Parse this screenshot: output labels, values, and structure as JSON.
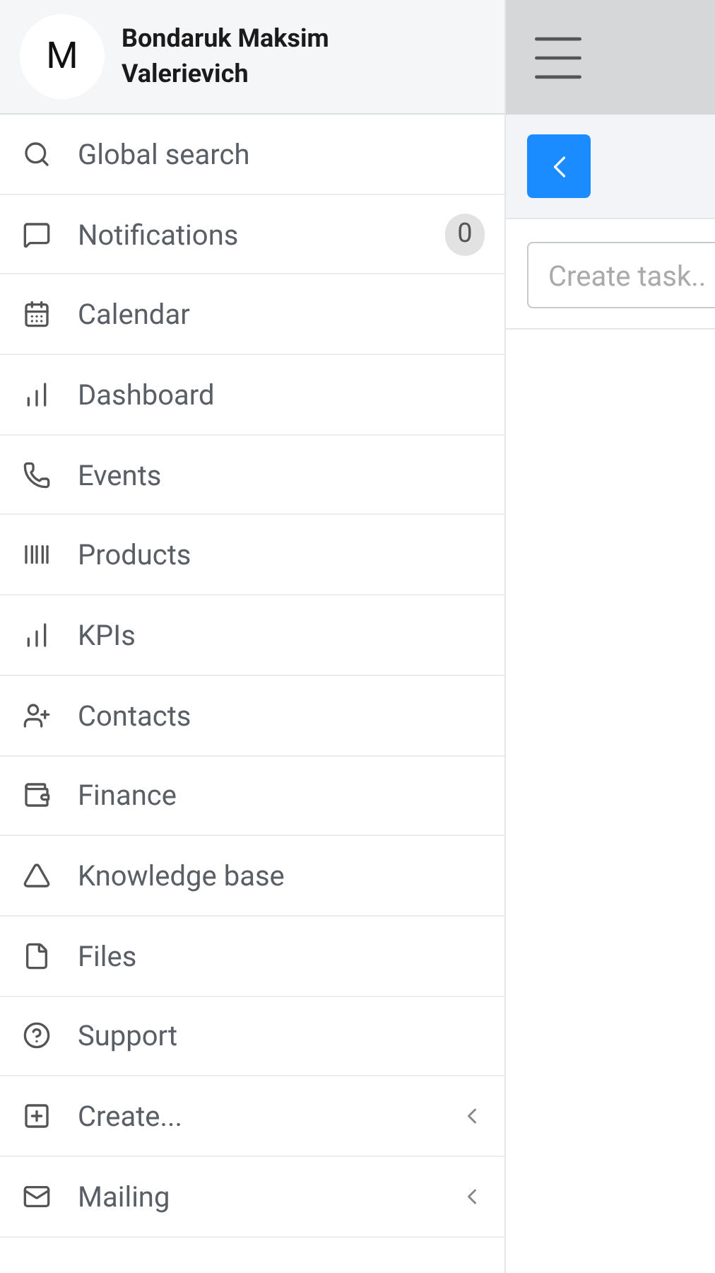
{
  "user": {
    "avatar_letter": "M",
    "name": "Bondaruk Maksim Valerievich"
  },
  "menu": [
    {
      "label": "Global search",
      "has_submenu": false
    },
    {
      "label": "Notifications",
      "badge": "0",
      "has_submenu": false
    },
    {
      "label": "Calendar",
      "has_submenu": false
    },
    {
      "label": "Dashboard",
      "has_submenu": false
    },
    {
      "label": "Events",
      "has_submenu": false
    },
    {
      "label": "Products",
      "has_submenu": false
    },
    {
      "label": "KPIs",
      "has_submenu": false
    },
    {
      "label": "Contacts",
      "has_submenu": false
    },
    {
      "label": "Finance",
      "has_submenu": false
    },
    {
      "label": "Knowledge base",
      "has_submenu": false
    },
    {
      "label": "Files",
      "has_submenu": false
    },
    {
      "label": "Support",
      "has_submenu": false
    },
    {
      "label": "Create...",
      "has_submenu": true
    },
    {
      "label": "Mailing",
      "has_submenu": true
    }
  ],
  "task_input": {
    "placeholder": "Create task.."
  }
}
